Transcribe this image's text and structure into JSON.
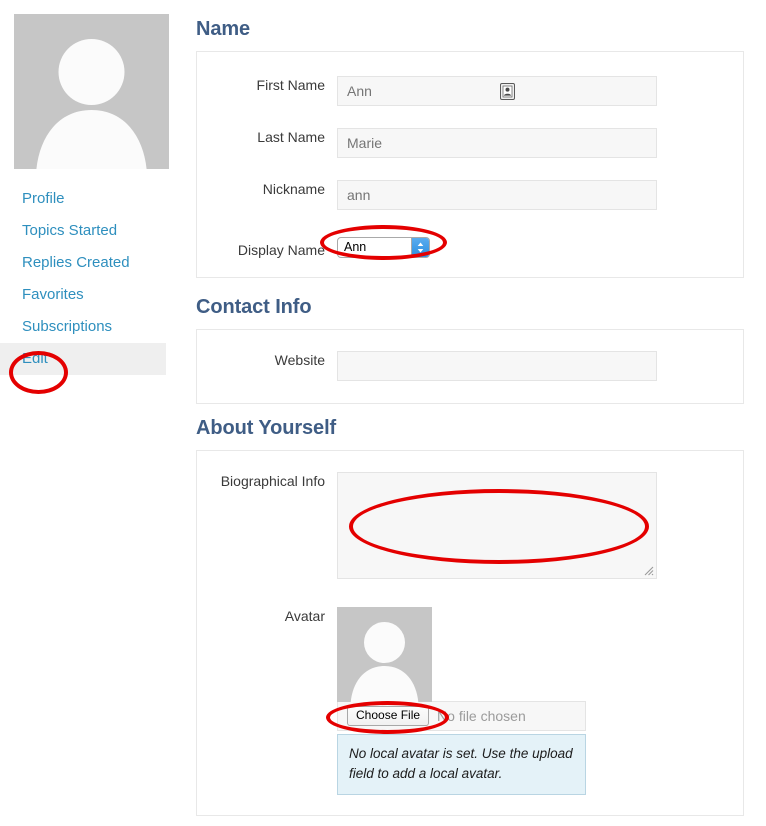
{
  "sidebar": {
    "avatar_alt": "default-user-avatar",
    "items": [
      {
        "label": "Profile",
        "current": false
      },
      {
        "label": "Topics Started",
        "current": false
      },
      {
        "label": "Replies Created",
        "current": false
      },
      {
        "label": "Favorites",
        "current": false
      },
      {
        "label": "Subscriptions",
        "current": false
      },
      {
        "label": "Edit",
        "current": true
      }
    ]
  },
  "sections": {
    "name": {
      "title": "Name",
      "fields": {
        "first_name": {
          "label": "First Name",
          "value": "",
          "placeholder": "Ann"
        },
        "last_name": {
          "label": "Last Name",
          "value": "",
          "placeholder": "Marie"
        },
        "nickname": {
          "label": "Nickname",
          "value": "",
          "placeholder": "ann"
        },
        "display_name": {
          "label": "Display Name",
          "selected": "Ann",
          "options": [
            "Ann"
          ]
        }
      }
    },
    "contact_info": {
      "title": "Contact Info",
      "fields": {
        "website": {
          "label": "Website",
          "value": "",
          "placeholder": ""
        }
      }
    },
    "about_yourself": {
      "title": "About Yourself",
      "fields": {
        "biographical_info": {
          "label": "Biographical Info",
          "value": "",
          "placeholder": ""
        },
        "avatar": {
          "label": "Avatar",
          "choose_file_label": "Choose File",
          "no_file_text": "No file chosen",
          "notice": "No local avatar is set. Use the upload field to add a local avatar."
        }
      }
    }
  },
  "colors": {
    "heading": "#3f5d85",
    "link": "#2e8fbe",
    "annotation": "#e40000",
    "input_bg": "#f7f7f7",
    "notice_bg": "#e4f2f8",
    "avatar_bg": "#c6c6c6"
  },
  "annotations": [
    {
      "name": "display-name-select",
      "shape": "ellipse"
    },
    {
      "name": "sidebar-edit-link",
      "shape": "ellipse"
    },
    {
      "name": "biographical-info-textarea",
      "shape": "ellipse"
    },
    {
      "name": "choose-file-button",
      "shape": "ellipse"
    }
  ]
}
